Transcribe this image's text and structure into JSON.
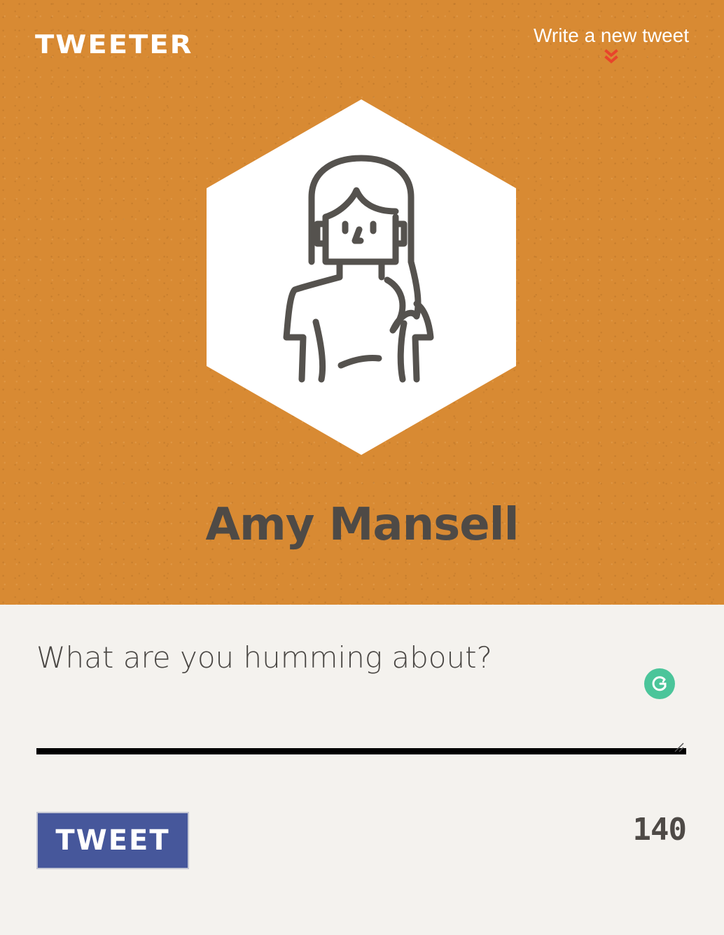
{
  "app": {
    "logo_text": "TWEETER"
  },
  "header": {
    "compose_link_label": "Write a new tweet",
    "compose_link_icon": "double-chevron-down-icon",
    "accent_color": "#e8442b"
  },
  "profile": {
    "name": "Amy Mansell",
    "avatar_icon": "user-avatar-woman-icon",
    "background_color": "#d88a33"
  },
  "compose": {
    "placeholder": "What are you humming about?",
    "value": "",
    "grammarly_icon": "grammarly-icon",
    "tweet_button_label": "TWEET",
    "tweet_button_color": "#46579b",
    "char_count": "140"
  }
}
